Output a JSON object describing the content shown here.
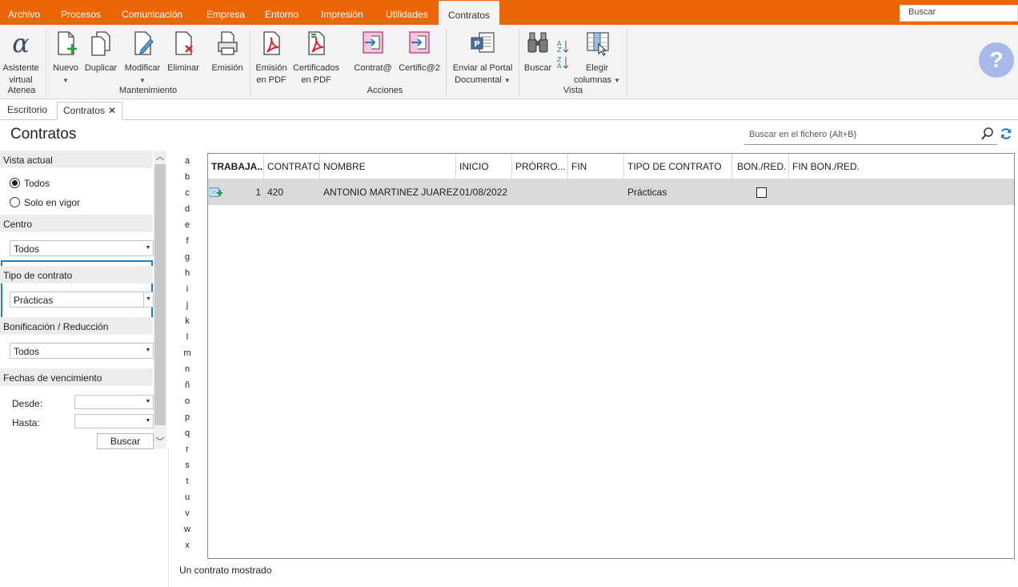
{
  "menubar": {
    "items": [
      "Archivo",
      "Procesos",
      "Comunicación",
      "Empresa",
      "Entorno",
      "Impresión",
      "Utilidades",
      "Contratos"
    ],
    "active": "Contratos",
    "search_placeholder": "Buscar",
    "accent_color": "#ec6608"
  },
  "ribbon": {
    "atenea": {
      "label": "Asistente virtual",
      "line1": "Asistente",
      "line2": "virtual",
      "group": "Atenea"
    },
    "mantenimiento": {
      "group": "Mantenimiento",
      "nuevo": "Nuevo",
      "duplicar": "Duplicar",
      "modificar": "Modificar",
      "eliminar": "Eliminar"
    },
    "emision": "Emisión",
    "acciones": {
      "group": "Acciones",
      "emision_pdf_1": "Emisión",
      "emision_pdf_2": "en PDF",
      "cert_pdf_1": "Certificados",
      "cert_pdf_2": "en PDF",
      "contrata": "Contrat@",
      "certifica": "Certific@2",
      "portal_1": "Enviar al Portal",
      "portal_2": "Documental"
    },
    "vista": {
      "group": "Vista",
      "buscar": "Buscar",
      "elegir_1": "Elegir",
      "elegir_2": "columnas"
    }
  },
  "tabs": [
    {
      "label": "Escritorio"
    },
    {
      "label": "Contratos"
    }
  ],
  "page": {
    "title": "Contratos",
    "file_search_placeholder": "Buscar en el fichero (Alt+B)"
  },
  "filters": {
    "vista_actual": {
      "header": "Vista actual",
      "options": [
        "Todos",
        "Solo en vigor"
      ],
      "selected": "Todos"
    },
    "centro": {
      "header": "Centro",
      "value": "Todos"
    },
    "tipo_contrato": {
      "header": "Tipo de contrato",
      "value": "Prácticas"
    },
    "bonificacion": {
      "header": "Bonificación / Reducción",
      "value": "Todos"
    },
    "fechas": {
      "header": "Fechas de vencimiento",
      "desde": "Desde:",
      "hasta": "Hasta:"
    },
    "buscar_button": "Buscar"
  },
  "alphabet": [
    "a",
    "b",
    "c",
    "d",
    "e",
    "f",
    "g",
    "h",
    "i",
    "j",
    "k",
    "l",
    "m",
    "n",
    "ñ",
    "o",
    "p",
    "q",
    "r",
    "s",
    "t",
    "u",
    "v",
    "w",
    "x"
  ],
  "grid": {
    "columns": [
      "TRABAJA...",
      "CONTRATO",
      "NOMBRE",
      "INICIO",
      "PRÓRRO...",
      "FIN",
      "TIPO DE CONTRATO",
      "BON./RED.",
      "FIN BON./RED."
    ],
    "rows": [
      {
        "trabajador": "1",
        "contrato": "420",
        "nombre": "ANTONIO MARTINEZ JUAREZ",
        "inicio": "01/08/2022",
        "prorroga": "",
        "fin": "",
        "tipo": "Prácticas",
        "bon_red": false,
        "fin_bon_red": ""
      }
    ]
  },
  "status": "Un contrato mostrado"
}
